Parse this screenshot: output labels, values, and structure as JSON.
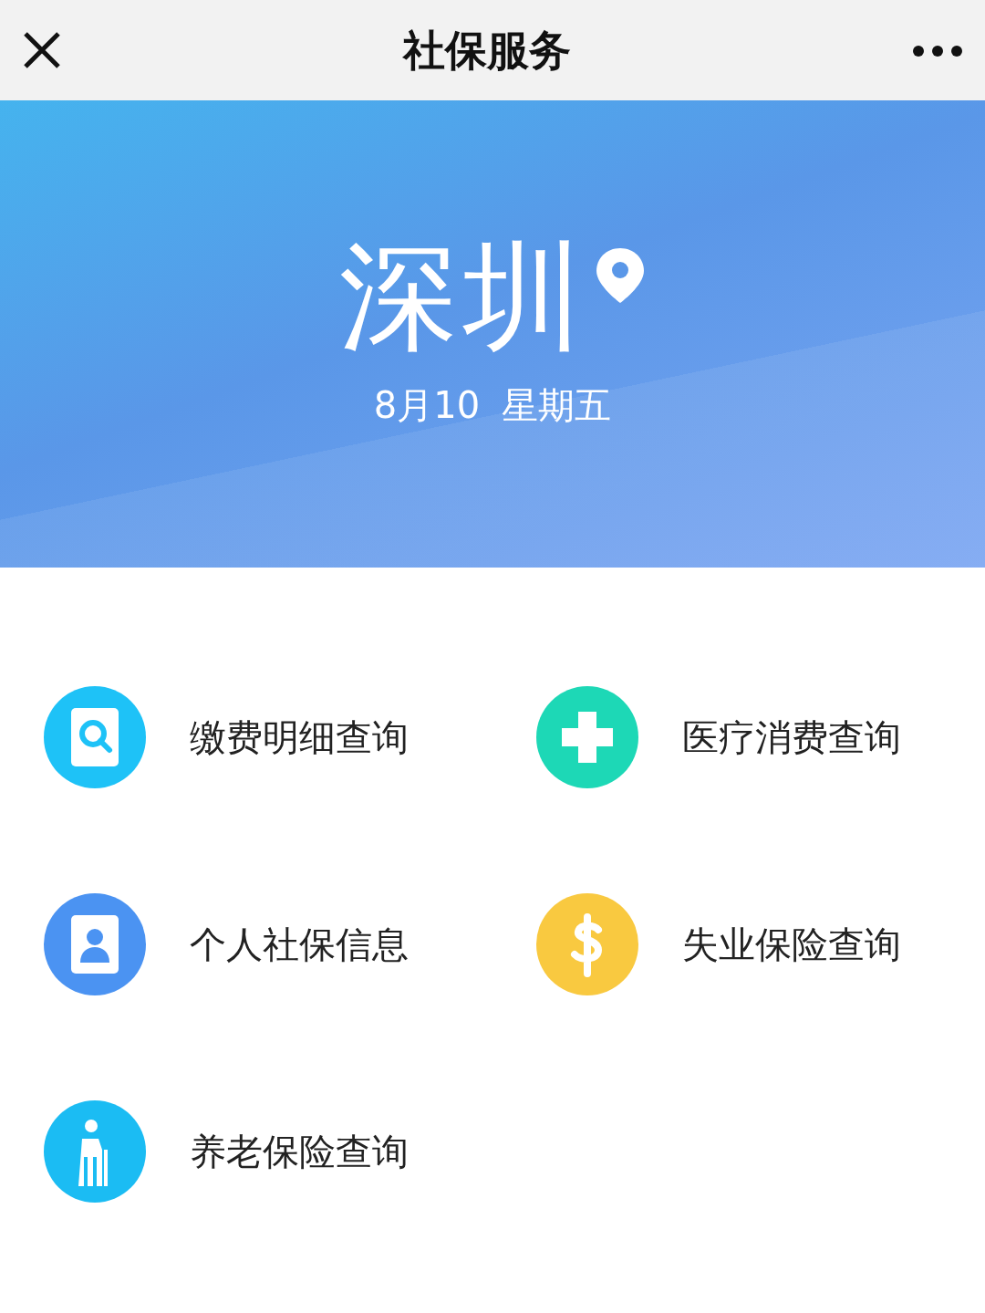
{
  "header": {
    "title": "社保服务"
  },
  "banner": {
    "city": "深圳",
    "date": "8月10",
    "weekday": "星期五"
  },
  "services": [
    {
      "label": "缴费明细查询",
      "kind": "search-doc",
      "color": "#1ec2f7"
    },
    {
      "label": "医疗消费查询",
      "kind": "medical",
      "color": "#1dd8b6"
    },
    {
      "label": "个人社保信息",
      "kind": "person-card",
      "color": "#4b93f2"
    },
    {
      "label": "失业保险查询",
      "kind": "dollar",
      "color": "#f9c940"
    },
    {
      "label": "养老保险查询",
      "kind": "elder",
      "color": "#1bbcf3"
    }
  ]
}
